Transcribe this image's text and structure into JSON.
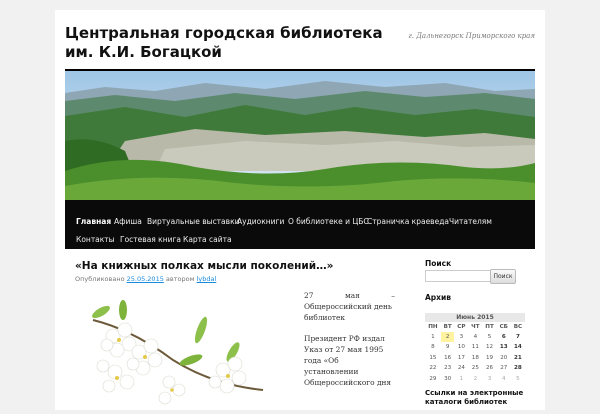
{
  "site": {
    "title": "Центральная городская библиотека им. К.И. Богацкой",
    "description": "г. Дальнегорск Приморского края"
  },
  "nav": [
    {
      "label": "Главная",
      "active": true
    },
    {
      "label": "Афиша"
    },
    {
      "label": "Виртуальные выставки"
    },
    {
      "label": "Аудиокниги"
    },
    {
      "label": "О библиотеке и ЦБС"
    },
    {
      "label": "Страничка краеведа"
    },
    {
      "label": "Читателям"
    },
    {
      "label": "Контакты"
    },
    {
      "label": "Гостевая книга"
    },
    {
      "label": "Карта сайта"
    }
  ],
  "post": {
    "title": "«На книжных полках мысли поколений…»",
    "meta_prefix": "Опубликовано",
    "date": "25.05.2015",
    "meta_author_prefix": "автором",
    "author": "lybdal",
    "paragraph1_line1": "27 мая –",
    "paragraph1_line2": "Общероссийский день",
    "paragraph1_line3": "библиотек",
    "paragraph2_line1": "Президент РФ издал",
    "paragraph2_line2": "Указ от 27 мая 1995",
    "paragraph2_line3": "года «Об",
    "paragraph2_line4": "установлении",
    "paragraph2_line5": "Общероссийского дня"
  },
  "sidebar": {
    "search_title": "Поиск",
    "search_value": "",
    "search_button": "Поиск",
    "archive_title": "Архив",
    "calendar_caption": "Июнь 2015",
    "weekdays": [
      "ПН",
      "ВТ",
      "СР",
      "ЧТ",
      "ПТ",
      "СБ",
      "ВС"
    ],
    "weeks": [
      [
        "1",
        "2",
        "3",
        "4",
        "5",
        "6",
        "7"
      ],
      [
        "8",
        "9",
        "10",
        "11",
        "12",
        "13",
        "14"
      ],
      [
        "15",
        "16",
        "17",
        "18",
        "19",
        "20",
        "21"
      ],
      [
        "22",
        "23",
        "24",
        "25",
        "26",
        "27",
        "28"
      ],
      [
        "29",
        "30",
        "1",
        "2",
        "3",
        "4",
        "5"
      ]
    ],
    "links_title": "Ссылки на электронные каталоги библиотек"
  }
}
